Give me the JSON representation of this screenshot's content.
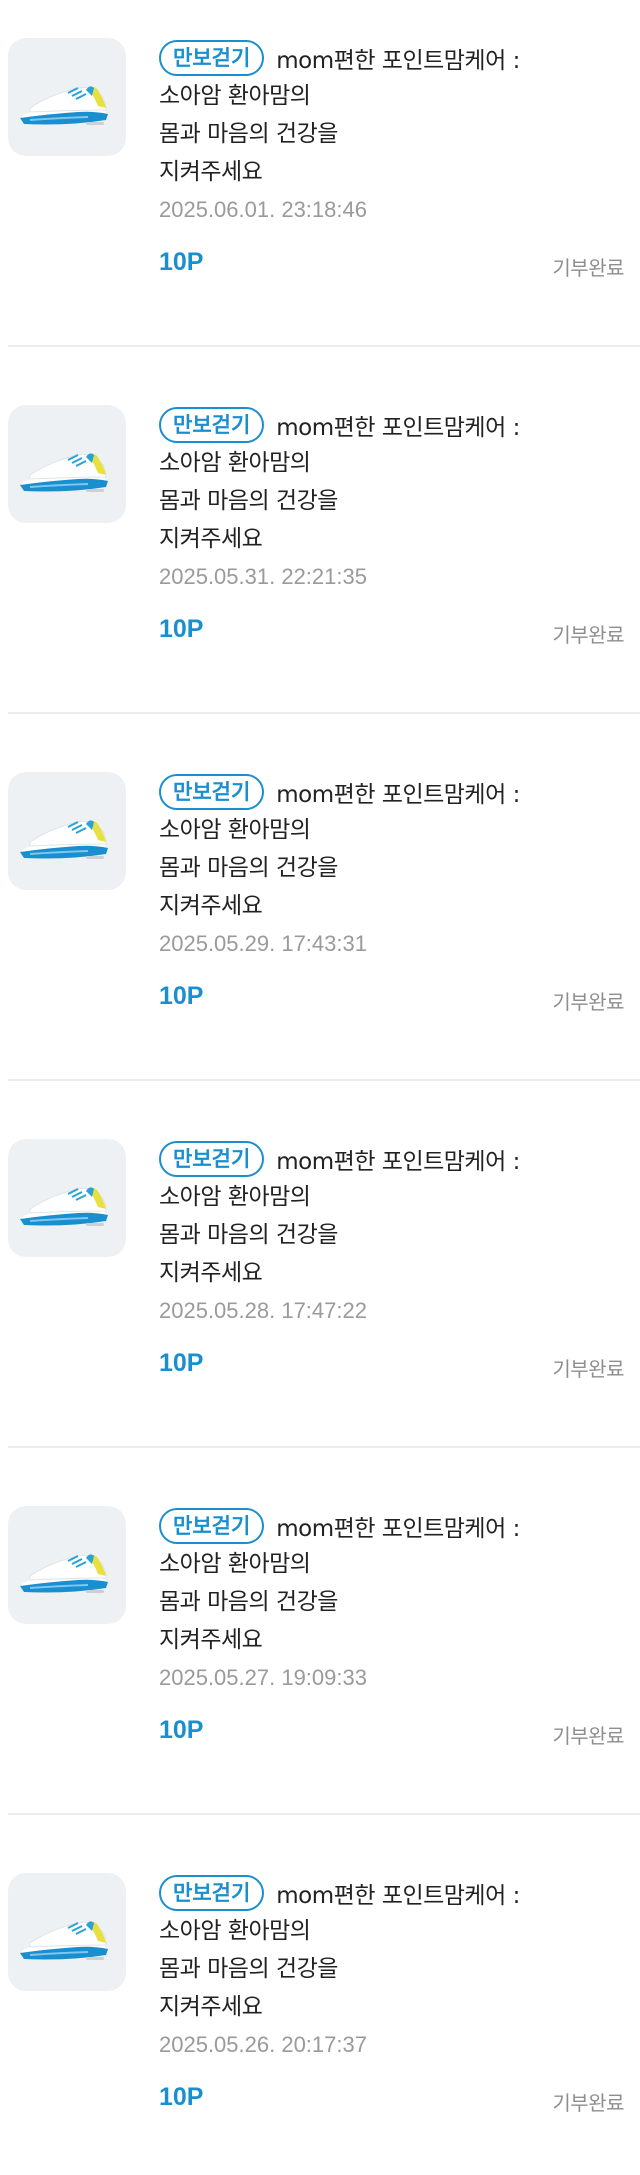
{
  "items": [
    {
      "icon": "sneaker-icon",
      "badge": "만보걷기",
      "title": "mom편한 포인트맘케어 :",
      "line1": "소아암 환아맘의",
      "line2": "몸과 마음의 건강을",
      "line3": "지켜주세요",
      "timestamp": "2025.06.01. 23:18:46",
      "points": "10P",
      "status": "기부완료"
    },
    {
      "icon": "sneaker-icon",
      "badge": "만보걷기",
      "title": "mom편한 포인트맘케어 :",
      "line1": "소아암 환아맘의",
      "line2": "몸과 마음의 건강을",
      "line3": "지켜주세요",
      "timestamp": "2025.05.31. 22:21:35",
      "points": "10P",
      "status": "기부완료"
    },
    {
      "icon": "sneaker-icon",
      "badge": "만보걷기",
      "title": "mom편한 포인트맘케어 :",
      "line1": "소아암 환아맘의",
      "line2": "몸과 마음의 건강을",
      "line3": "지켜주세요",
      "timestamp": "2025.05.29. 17:43:31",
      "points": "10P",
      "status": "기부완료"
    },
    {
      "icon": "sneaker-icon",
      "badge": "만보걷기",
      "title": "mom편한 포인트맘케어 :",
      "line1": "소아암 환아맘의",
      "line2": "몸과 마음의 건강을",
      "line3": "지켜주세요",
      "timestamp": "2025.05.28. 17:47:22",
      "points": "10P",
      "status": "기부완료"
    },
    {
      "icon": "sneaker-icon",
      "badge": "만보걷기",
      "title": "mom편한 포인트맘케어 :",
      "line1": "소아암 환아맘의",
      "line2": "몸과 마음의 건강을",
      "line3": "지켜주세요",
      "timestamp": "2025.05.27. 19:09:33",
      "points": "10P",
      "status": "기부완료"
    },
    {
      "icon": "sneaker-icon",
      "badge": "만보걷기",
      "title": "mom편한 포인트맘케어 :",
      "line1": "소아암 환아맘의",
      "line2": "몸과 마음의 건강을",
      "line3": "지켜주세요",
      "timestamp": "2025.05.26. 20:17:37",
      "points": "10P",
      "status": "기부완료"
    }
  ],
  "colors": {
    "accent": "#1a8fd0",
    "muted": "#9a9a9a",
    "thumb_bg": "#eef1f4",
    "divider": "#ececec"
  }
}
